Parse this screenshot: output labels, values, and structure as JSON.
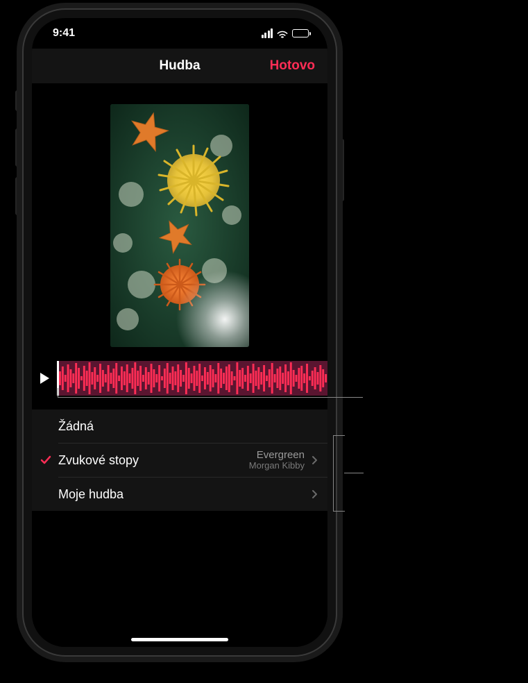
{
  "status": {
    "time": "9:41"
  },
  "nav": {
    "title": "Hudba",
    "done": "Hotovo"
  },
  "options": {
    "none_label": "Žádná",
    "tracks_label": "Zvukové stopy",
    "tracks_song_title": "Evergreen",
    "tracks_song_artist": "Morgan Kibby",
    "mymusic_label": "Moje hudba"
  }
}
